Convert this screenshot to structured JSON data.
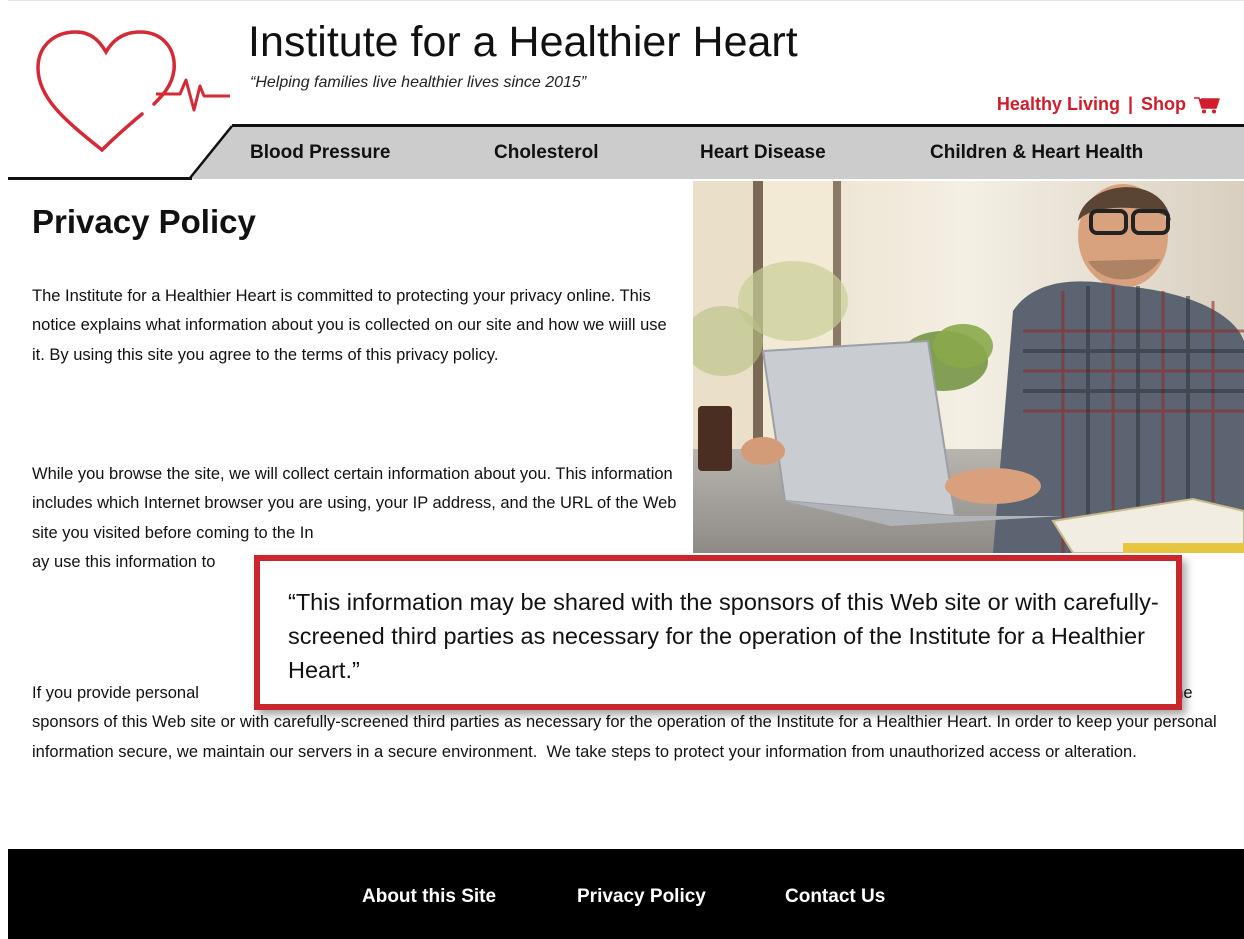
{
  "site": {
    "title": "Institute for a Healthier Heart",
    "tagline": "“Helping families live healthier lives since 2015”"
  },
  "utility_nav": {
    "healthy_living": "Healthy Living",
    "separator": "|",
    "shop": "Shop",
    "cart_icon": "shopping-cart-icon"
  },
  "main_nav": [
    {
      "label": "Blood Pressure"
    },
    {
      "label": "Cholesterol"
    },
    {
      "label": "Heart Disease"
    },
    {
      "label": "Children & Heart Health"
    }
  ],
  "content": {
    "page_title": "Privacy Policy",
    "paragraphs": [
      "The Institute for a Healthier Heart is committed to protecting your privacy online. This notice explains what information about you is collected on our site and how we wiill use it. By using this site you agree to the terms of this privacy policy.",
      "While you browse the site, we will collect certain information about you. This information includes which Internet browser you are using, your IP address, and the URL of the Web site you visited before coming to the In                                                                                                     ay use this information to",
      "If you provide personal                                                                                                                                                         This information may be shared with the sponsors of this Web site or with carefully-screened third parties as necessary for the operation of the Institute for a Healthier Heart. In order to keep your personal information secure, we maintain our servers in a secure environment.  We take steps to protect your information from unauthorized access or alteration."
    ]
  },
  "callout": {
    "quote": "“This information may be shared with the sponsors of this Web site or with carefully-screened third parties as necessary for the operation of the Institute for a Healthier Heart.”"
  },
  "footer": {
    "links": [
      {
        "label": "About this Site"
      },
      {
        "label": "Privacy Policy"
      },
      {
        "label": "Contact Us"
      }
    ]
  },
  "colors": {
    "brand_red": "#d11d2b",
    "callout_border": "#c9262d",
    "nav_bar": "#cccccc",
    "footer_bg": "#000000"
  },
  "icons": [
    "heart-pulse-logo-icon",
    "shopping-cart-icon"
  ],
  "images": [
    "hero-photo-man-at-laptop"
  ]
}
